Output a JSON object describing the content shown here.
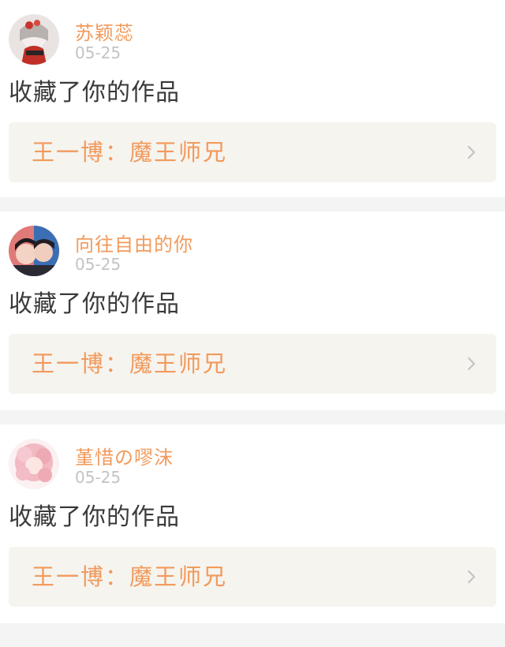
{
  "feed": {
    "items": [
      {
        "username": "苏颖蕊",
        "date": "05-25",
        "action": "收藏了你的作品",
        "work_title": "王一博：魔王师兄",
        "avatar_icon": "avatar-girl-red-icon"
      },
      {
        "username": "向往自由的你",
        "date": "05-25",
        "action": "收藏了你的作品",
        "work_title": "王一博：魔王师兄",
        "avatar_icon": "avatar-couple-icon"
      },
      {
        "username": "堇惜の嘐沫",
        "date": "05-25",
        "action": "收藏了你的作品",
        "work_title": "王一博：魔王师兄",
        "avatar_icon": "avatar-pink-hair-icon"
      }
    ]
  },
  "colors": {
    "accent": "#f29a5c",
    "muted": "#c3c3c3",
    "text": "#3a3a3a",
    "link_bg": "#f5f4ef",
    "page_bg": "#f4f4f4"
  }
}
